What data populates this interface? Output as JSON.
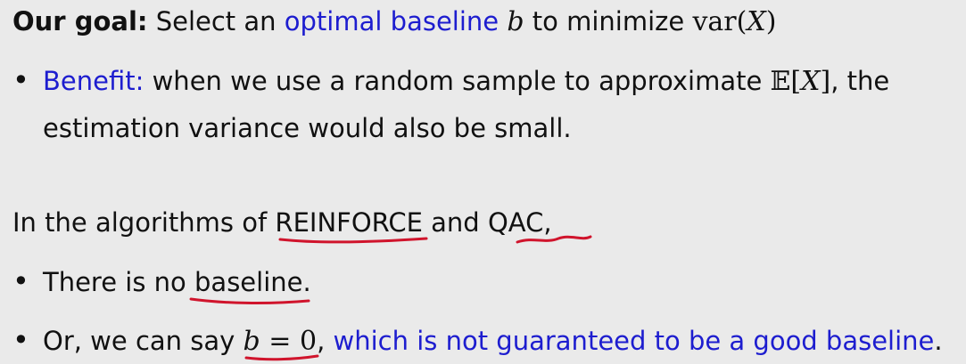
{
  "goal": {
    "label": "Our goal:",
    "text_1": "Select an",
    "highlight": "optimal baseline",
    "var_b": "b",
    "text_2": "to minimize",
    "math_func": "var",
    "math_open": "(",
    "math_x": "X",
    "math_close": ")"
  },
  "benefit": {
    "bullet": "•",
    "label": "Benefit:",
    "text_1": "when we use a random sample to approximate",
    "math_e": "𝔼",
    "math_open": "[",
    "math_x": "X",
    "math_close": "]",
    "text_2": ", the",
    "continuation": "estimation variance would also be small."
  },
  "algorithms": {
    "text_1": "In the algorithms of",
    "reinforce": "REINFORCE",
    "text_2": "and",
    "qac": "QAC,"
  },
  "bullets": [
    {
      "bullet": "•",
      "text_1": "There is no",
      "underlined": "baseline",
      "text_2": "."
    },
    {
      "bullet": "•",
      "text_1": "Or, we can say",
      "math_b": "b",
      "math_eq": " = ",
      "math_zero": "0",
      "comma": ",",
      "blue_text": "which is not guaranteed to be a good baseline",
      "end": "."
    }
  ],
  "colors": {
    "background": "#eaeaea",
    "text": "#111111",
    "highlight_blue": "#1d1dcf",
    "annotation_red": "#d0142c"
  }
}
